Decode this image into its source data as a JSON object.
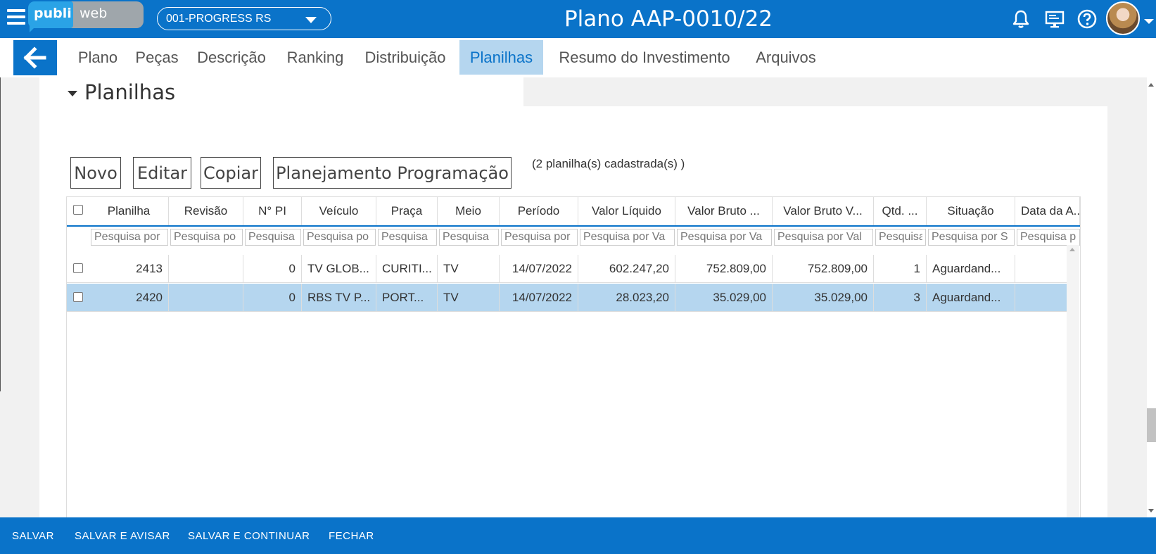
{
  "header": {
    "logo_left": "publi",
    "logo_right": "web",
    "agency_select": "001-PROGRESS RS",
    "title": "Plano AAP-0010/22"
  },
  "icons": {
    "menu": "hamburger-menu-icon",
    "bell": "bell-icon",
    "monitor": "monitor-icon",
    "help": "help-icon",
    "back": "arrow-left-icon"
  },
  "tabs": [
    {
      "label": "Plano"
    },
    {
      "label": "Peças"
    },
    {
      "label": "Descrição"
    },
    {
      "label": "Ranking"
    },
    {
      "label": "Distribuição"
    },
    {
      "label": "Planilhas",
      "active": true
    },
    {
      "label": "Resumo do Investimento"
    },
    {
      "label": "Arquivos"
    }
  ],
  "section": {
    "title": "Planilhas",
    "buttons": {
      "novo": "Novo",
      "editar": "Editar",
      "copiar": "Copiar",
      "planejamento": "Planejamento Programação"
    },
    "count_text": "(2   planilha(s) cadastrada(s) )"
  },
  "grid": {
    "columns": [
      "Planilha",
      "Revisão",
      "N° PI",
      "Veículo",
      "Praça",
      "Meio",
      "Período",
      "Valor Líquido",
      "Valor Bruto ...",
      "Valor Bruto V...",
      "Qtd. ...",
      "Situação",
      "Data da A..."
    ],
    "filter_placeholders": [
      "Pesquisa por",
      "Pesquisa po",
      "Pesquisa",
      "Pesquisa po",
      "Pesquisa",
      "Pesquisa",
      "Pesquisa por",
      "Pesquisa por Va",
      "Pesquisa por Va",
      "Pesquisa por Val",
      "Pesquisa",
      "Pesquisa por S",
      "Pesquisa p"
    ],
    "rows": [
      {
        "planilha": "2413",
        "revisao": "",
        "npi": "0",
        "veiculo": "TV GLOB...",
        "praca": "CURITI...",
        "meio": "TV",
        "periodo": "14/07/2022",
        "valor_liquido": "602.247,20",
        "valor_bruto": "752.809,00",
        "valor_bruto_v": "752.809,00",
        "qtd": "1",
        "situacao": "Aguardand...",
        "data": "",
        "selected": false
      },
      {
        "planilha": "2420",
        "revisao": "",
        "npi": "0",
        "veiculo": "RBS TV P...",
        "praca": "PORT...",
        "meio": "TV",
        "periodo": "14/07/2022",
        "valor_liquido": "28.023,20",
        "valor_bruto": "35.029,00",
        "valor_bruto_v": "35.029,00",
        "qtd": "3",
        "situacao": "Aguardand...",
        "data": "",
        "selected": true
      }
    ]
  },
  "footer": {
    "salvar": "SALVAR",
    "salvar_avisar": "SALVAR E AVISAR",
    "salvar_continuar": "SALVAR E CONTINUAR",
    "fechar": "FECHAR"
  },
  "colors": {
    "primary": "#0a73c9",
    "selected_row": "#b5d6ef",
    "logo_blue": "#2aa3e6",
    "logo_grey": "#9fa6ab"
  }
}
